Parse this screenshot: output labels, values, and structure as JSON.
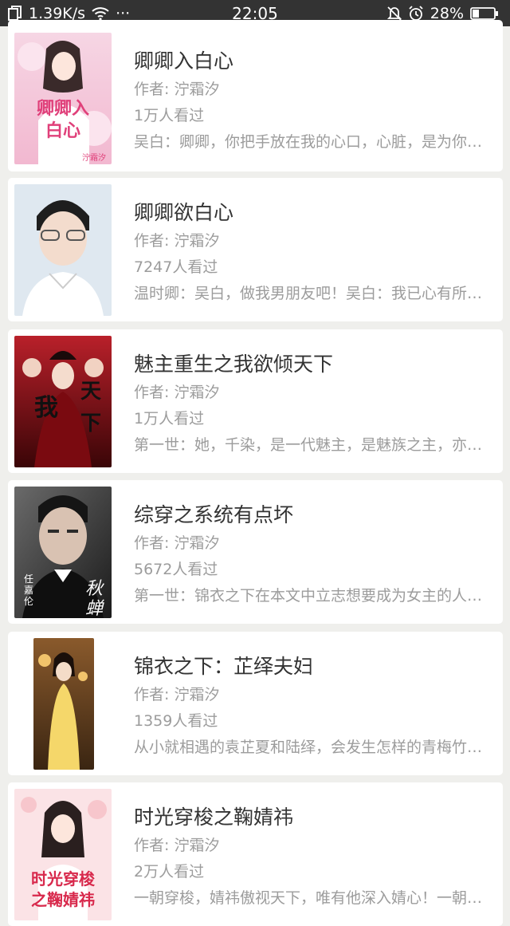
{
  "status_bar": {
    "net_speed": "1.39K/s",
    "more_dots": "···",
    "time": "22:05",
    "battery": "28%"
  },
  "books": [
    {
      "title": "卿卿入白心",
      "author": "作者: 泞霜汐",
      "views": "1万人看过",
      "desc": "吴白：卿卿，你把手放在我的心口，心脏，是为你跳动的。",
      "cover_text": "卿卿入白心",
      "cover_author": "泞霜汐"
    },
    {
      "title": "卿卿欲白心",
      "author": "作者: 泞霜汐",
      "views": "7247人看过",
      "desc": "温时卿：吴白，做我男朋友吧！吴白：我已心有所属。"
    },
    {
      "title": "魅主重生之我欲倾天下",
      "author": "作者: 泞霜汐",
      "views": "1万人看过",
      "desc": "第一世：她，千染，是一代魅主，是魅族之主，亦是天下之主。",
      "cover_text": "我欲倾天下"
    },
    {
      "title": "综穿之系统有点坏",
      "author": "作者: 泞霜汐",
      "views": "5672人看过",
      "desc": "第一世：锦衣之下在本文中立志想要成为女主的人生赢家。",
      "cover_text": "秋蝉",
      "cover_side": "任嘉伦"
    },
    {
      "title": "锦衣之下：芷绎夫妇",
      "author": "作者: 泞霜汐",
      "views": "1359人看过",
      "desc": "从小就相遇的袁芷夏和陆绎，会发生怎样的青梅竹马的故事呢？"
    },
    {
      "title": "时光穿梭之鞠婧祎",
      "author": "作者: 泞霜汐",
      "views": "2万人看过",
      "desc": "一朝穿梭，婧祎傲视天下，唯有他深入婧心！一朝穿梭。",
      "cover_text": "时光穿梭之鞠婧祎"
    }
  ],
  "colors": {
    "background": "#efefec",
    "card": "#ffffff",
    "title": "#333333",
    "meta": "#9c9c9c",
    "status_bar": "#333333"
  }
}
